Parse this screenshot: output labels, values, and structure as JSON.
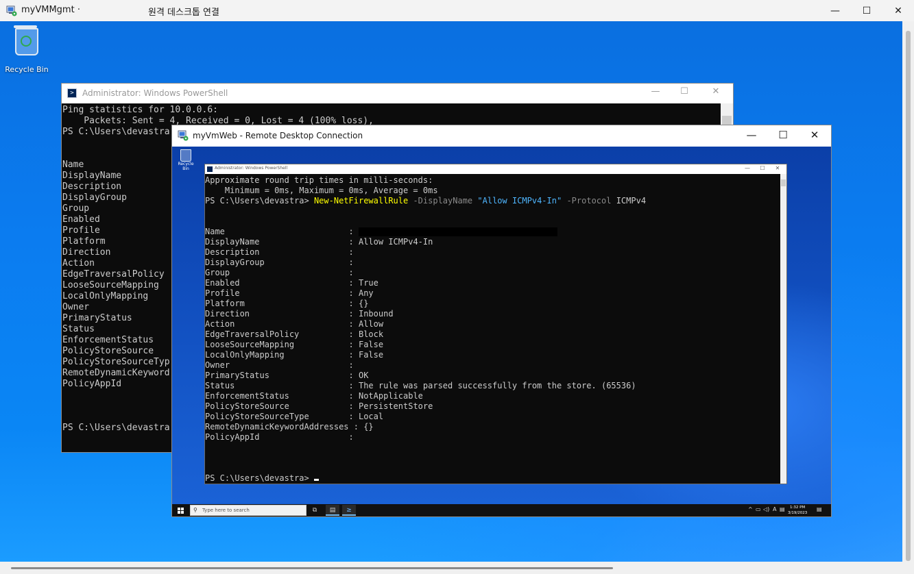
{
  "outer_window": {
    "title": "myVMMgmt ·",
    "subtitle": "원격 데스크톱 연결",
    "minimize_glyph": "—",
    "maximize_glyph": "☐",
    "close_glyph": "✕"
  },
  "desktop": {
    "recycle_bin_label": "Recycle Bin"
  },
  "local_powershell": {
    "title": "Administrator: Windows PowerShell",
    "minimize_glyph": "—",
    "maximize_glyph": "☐",
    "close_glyph": "✕",
    "lines": [
      "Ping statistics for 10.0.0.6:",
      "    Packets: Sent = 4, Received = 0, Lost = 4 (100% loss),",
      "PS C:\\Users\\devastra",
      "",
      "",
      "Name",
      "DisplayName",
      "Description",
      "DisplayGroup",
      "Group",
      "Enabled",
      "Profile",
      "Platform",
      "Direction",
      "Action",
      "EdgeTraversalPolicy",
      "LooseSourceMapping",
      "LocalOnlyMapping",
      "Owner",
      "PrimaryStatus",
      "Status",
      "EnforcementStatus",
      "PolicyStoreSource",
      "PolicyStoreSourceTyp",
      "RemoteDynamicKeyword",
      "PolicyAppId",
      "",
      "",
      "",
      "PS C:\\Users\\devastra"
    ]
  },
  "remote_window": {
    "title": "myVmWeb - Remote Desktop Connection",
    "minimize_glyph": "—",
    "maximize_glyph": "☐",
    "close_glyph": "✕",
    "recycle_bin_label": "Recycle Bin"
  },
  "remote_powershell": {
    "title": "Administrator: Windows PowerShell",
    "minimize_glyph": "—",
    "maximize_glyph": "☐",
    "close_glyph": "✕",
    "ping_line_1": "Approximate round trip times in milli-seconds:",
    "ping_line_2": "    Minimum = 0ms, Maximum = 0ms, Average = 0ms",
    "prompt": "PS C:\\Users\\devastra> ",
    "command": "New-NetFirewallRule",
    "param_1": " -DisplayName ",
    "param_1_value": "\"Allow ICMPv4-In\"",
    "param_2": " -Protocol ",
    "param_2_value": "ICMPv4",
    "properties": [
      {
        "key": "Name                         : ",
        "value": "",
        "redacted": true
      },
      {
        "key": "DisplayName                  : ",
        "value": "Allow ICMPv4-In"
      },
      {
        "key": "Description                  : ",
        "value": ""
      },
      {
        "key": "DisplayGroup                 : ",
        "value": ""
      },
      {
        "key": "Group                        : ",
        "value": ""
      },
      {
        "key": "Enabled                      : ",
        "value": "True"
      },
      {
        "key": "Profile                      : ",
        "value": "Any"
      },
      {
        "key": "Platform                     : ",
        "value": "{}"
      },
      {
        "key": "Direction                    : ",
        "value": "Inbound"
      },
      {
        "key": "Action                       : ",
        "value": "Allow"
      },
      {
        "key": "EdgeTraversalPolicy          : ",
        "value": "Block"
      },
      {
        "key": "LooseSourceMapping           : ",
        "value": "False"
      },
      {
        "key": "LocalOnlyMapping             : ",
        "value": "False"
      },
      {
        "key": "Owner                        : ",
        "value": ""
      },
      {
        "key": "PrimaryStatus                : ",
        "value": "OK"
      },
      {
        "key": "Status                       : ",
        "value": "The rule was parsed successfully from the store. (65536)"
      },
      {
        "key": "EnforcementStatus            : ",
        "value": "NotApplicable"
      },
      {
        "key": "PolicyStoreSource            : ",
        "value": "PersistentStore"
      },
      {
        "key": "PolicyStoreSourceType        : ",
        "value": "Local"
      },
      {
        "key": "RemoteDynamicKeywordAddresses : ",
        "value": "{}"
      },
      {
        "key": "PolicyAppId                  : ",
        "value": ""
      }
    ],
    "final_prompt": "PS C:\\Users\\devastra> "
  },
  "remote_taskbar": {
    "search_placeholder": "Type here to search",
    "search_icon": "⚲",
    "task_view_icon": "⧉",
    "server_manager_icon": "▤",
    "powershell_icon": "≥",
    "tray_up": "^",
    "tray_network": "▭",
    "tray_volume": "◁)",
    "tray_ime": "A",
    "tray_notification": "▤",
    "time": "1:32 PM",
    "date": "3/19/2023"
  }
}
